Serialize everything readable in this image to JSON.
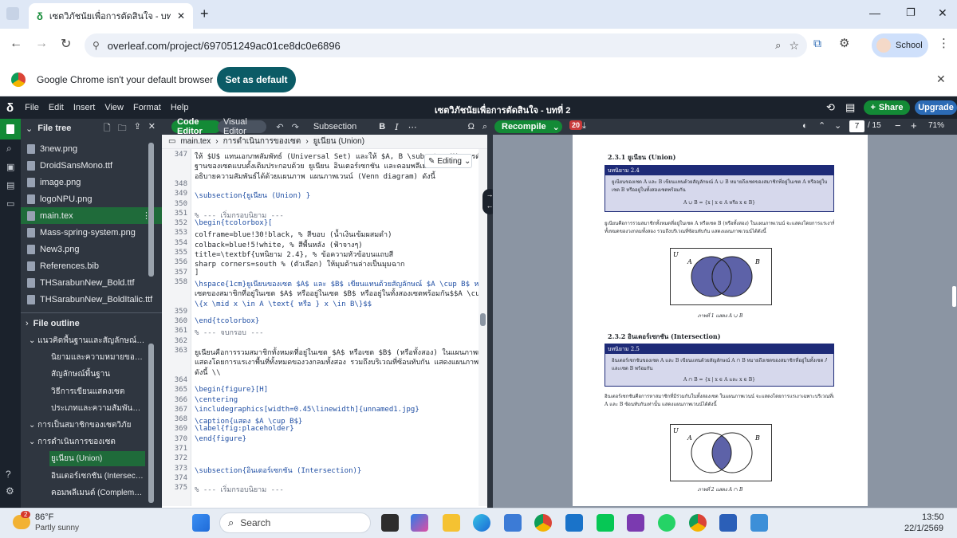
{
  "browser": {
    "tab_title": "เซตวิภัชนัยเพื่อการตัดสินใจ - บทที่ 2",
    "url": "overleaf.com/project/697051249ac01ce8dc0e6896",
    "profile_label": "School",
    "info_message": "Google Chrome isn't your default browser",
    "set_default_label": "Set as default"
  },
  "overleaf": {
    "menu": [
      "File",
      "Edit",
      "Insert",
      "View",
      "Format",
      "Help"
    ],
    "project_title": "เซตวิภัชนัยเพื่อการตัดสินใจ - บทที่ 2",
    "share_label": "Share",
    "upgrade_label": "Upgrade"
  },
  "file_tree": {
    "title": "File tree",
    "files": [
      "3new.png",
      "DroidSansMono.ttf",
      "image.png",
      "logoNPU.png",
      "main.tex",
      "Mass-spring-system.png",
      "New3.png",
      "References.bib",
      "THSarabunNew_Bold.ttf",
      "THSarabunNew_BoldItalic.ttf"
    ],
    "selected": "main.tex"
  },
  "outline": {
    "title": "File outline",
    "items": [
      {
        "label": "แนวคิดพื้นฐานและสัญลักษณ์ของ...",
        "level": 0
      },
      {
        "label": "นิยามและความหมายของเซต",
        "level": 1
      },
      {
        "label": "สัญลักษณ์พื้นฐาน",
        "level": 1
      },
      {
        "label": "วิธีการเขียนแสดงเซต",
        "level": 1
      },
      {
        "label": "ประเภทและความสัมพันธ์ของ...",
        "level": 1
      },
      {
        "label": "การเป็นสมาชิกของเซตวิภัย",
        "level": 0
      },
      {
        "label": "การดำเนินการของเซต",
        "level": 0
      },
      {
        "label": "ยูเนียน (Union)",
        "level": 1,
        "selected": true
      },
      {
        "label": "อินเตอร์เซกชัน (Intersection)",
        "level": 1
      },
      {
        "label": "คอมพลีเมนต์ (Complement)",
        "level": 1
      }
    ]
  },
  "editor": {
    "code_editor_label": "Code Editor",
    "visual_editor_label": "Visual Editor",
    "style_select": "Subsection",
    "breadcrumb": [
      "main.tex",
      "การดำเนินการของเซต",
      "ยูเนียน (Union)"
    ],
    "editing_label": "Editing",
    "lines": [
      {
        "n": "347",
        "t": "ให้ $U$ แทนเอกภพสัมพัทธ์ (Universal Set) และให้ $A, B \\subseteq U$ การดำเนินการพื้น"
      },
      {
        "n": "",
        "t": "ฐานของเซตแบบดั้งเดิมประกอบด้วย ยูเนียน อินเตอร์เซกชัน และคอมพลีเมนต์ ซึ่งสามา"
      },
      {
        "n": "",
        "t": "อธิบายความสัมพันธ์ได้ด้วยแผนภาพ แผนภาพเวนน์ (Venn diagram) ดังนี้"
      },
      {
        "n": "348",
        "t": ""
      },
      {
        "n": "349",
        "t": "\\subsection{ยูเนียน (Union) }"
      },
      {
        "n": "350",
        "t": ""
      },
      {
        "n": "351",
        "t": "% --- เริ่มกรอบนิยาม ---"
      },
      {
        "n": "352",
        "t": "\\begin{tcolorbox}["
      },
      {
        "n": "353",
        "t": "  colframe=blue!30!black,   % สีขอบ (น้ำเงินเข้มผสมดำ)"
      },
      {
        "n": "354",
        "t": "  colback=blue!5!white,     % สีพื้นหลัง (ฟ้าจางๆ)"
      },
      {
        "n": "355",
        "t": "  title=\\textbf{บทนิยาม 2.4}, % ข้อความหัวข้อบนแถบสี"
      },
      {
        "n": "356",
        "t": "  sharp corners=south       % (ตัวเลือก) ให้มุมด้านล่างเป็นมุมฉาก"
      },
      {
        "n": "357",
        "t": "]"
      },
      {
        "n": "358",
        "t": "  \\hspace{1cm}ยูเนียนของเซต $A$ และ $B$ เขียนแทนด้วยสัญลักษณ์ $A \\cup B$ หมายถึง"
      },
      {
        "n": "",
        "t": "  เซตของสมาชิกที่อยู่ในเซต $A$ หรืออยู่ในเซต $B$ หรืออยู่ในทั้งสองเซตพร้อมกัน$$A \\cup B ="
      },
      {
        "n": "",
        "t": "  \\{x \\mid x \\in A \\text{ หรือ } x \\in B\\}$$"
      },
      {
        "n": "359",
        "t": ""
      },
      {
        "n": "360",
        "t": "\\end{tcolorbox}"
      },
      {
        "n": "361",
        "t": "% --- จบกรอบ ---"
      },
      {
        "n": "362",
        "t": ""
      },
      {
        "n": "363",
        "t": "ยูเนียนคือการรวมสมาชิกทั้งหมดที่อยู่ในเซต $A$ หรือเซต $B$ (หรือทั้งสอง) ในแผนภาพเวนน์ จะ"
      },
      {
        "n": "",
        "t": "แสดงโดยการแรเงาพื้นที่ทั้งหมดของวงกลมทั้งสอง รวมถึงบริเวณที่ซ้อนทับกัน แสดงแผนภาพเวนน์ได้"
      },
      {
        "n": "",
        "t": "ดังนี้ \\\\"
      },
      {
        "n": "364",
        "t": ""
      },
      {
        "n": "365",
        "t": "\\begin{figure}[H]"
      },
      {
        "n": "366",
        "t": "   \\centering"
      },
      {
        "n": "367",
        "t": "   \\includegraphics[width=0.45\\linewidth]{unnamed1.jpg}"
      },
      {
        "n": "368",
        "t": "   \\caption{แสดง $A \\cup B$}"
      },
      {
        "n": "369",
        "t": "   \\label{fig:placeholder}"
      },
      {
        "n": "370",
        "t": "\\end{figure}"
      },
      {
        "n": "371",
        "t": ""
      },
      {
        "n": "372",
        "t": ""
      },
      {
        "n": "373",
        "t": "\\subsection{อินเตอร์เซกชัน (Intersection)}"
      },
      {
        "n": "374",
        "t": ""
      },
      {
        "n": "375",
        "t": "% --- เริ่มกรอบนิยาม ---"
      }
    ]
  },
  "pdf": {
    "recompile_label": "Recompile",
    "error_count": "20",
    "page_current": "7",
    "page_total": "/ 15",
    "zoom": "71%",
    "sec1_heading": "2.3.1  ยูเนียน (Union)",
    "def1_title": "บทนิยาม 2.4",
    "def1_text1": "ยูเนียนของเซต A และ B เขียนแทนด้วยสัญลักษณ์ A ∪ B หมายถึงเซตของสมาชิกที่อยู่ในเซต A หรืออยู่ใน",
    "def1_text2": "เซต B หรืออยู่ในทั้งสองเซตพร้อมกัน",
    "def1_formula": "A ∪ B = {x | x ∈ A หรือ x ∈ B}",
    "para1_a": "ยูเนียนคือการรวมสมาชิกทั้งหมดที่อยู่ในเซต A หรือเซต B (หรือทั้งสอง) ในแผนภาพเวนน์ จะแสดงโดยการแรเงาพื้นที่",
    "para1_b": "ทั้งหมดของวงกลมทั้งสอง รวมถึงบริเวณที่ซ้อนทับกัน แสดงแผนภาพเวนน์ได้ดังนี้",
    "fig1_caption": "ภาพที่ 1 แสดง A ∪ B",
    "sec2_heading": "2.3.2  อินเตอร์เซกชัน (Intersection)",
    "def2_title": "บทนิยาม 2.5",
    "def2_text1": "อินเตอร์เซกชันของเซต A และ B เขียนแทนด้วยสัญลักษณ์ A ∩ B หมายถึงเซตของสมาชิกที่อยู่ในทั้งเซต A",
    "def2_text2": "และเซต B พร้อมกัน",
    "def2_formula": "A ∩ B = {x | x ∈ A และ x ∈ B}",
    "para2_a": "อินเตอร์เซกชันคือการหาสมาชิกที่มีร่วมกันในทั้งสองเซต ในแผนภาพเวนน์ จะแสดงโดยการแรเงาเฉพาะบริเวณที่เซต",
    "para2_b": "A และ B ซ้อนทับกันเท่านั้น แสดงแผนภาพเวนน์ได้ดังนี้",
    "fig2_caption": "ภาพที่ 2 แสดง A ∩ B",
    "venn_u": "U",
    "venn_a": "A",
    "venn_b": "B"
  },
  "taskbar": {
    "weather_temp": "86°F",
    "weather_desc": "Partly sunny",
    "weather_badge": "2",
    "search_placeholder": "Search",
    "time": "13:50",
    "date": "22/1/2569"
  },
  "colors": {
    "overleaf_green": "#138a36",
    "venn_fill": "#5d62a8",
    "def_header": "#1e2b78"
  }
}
